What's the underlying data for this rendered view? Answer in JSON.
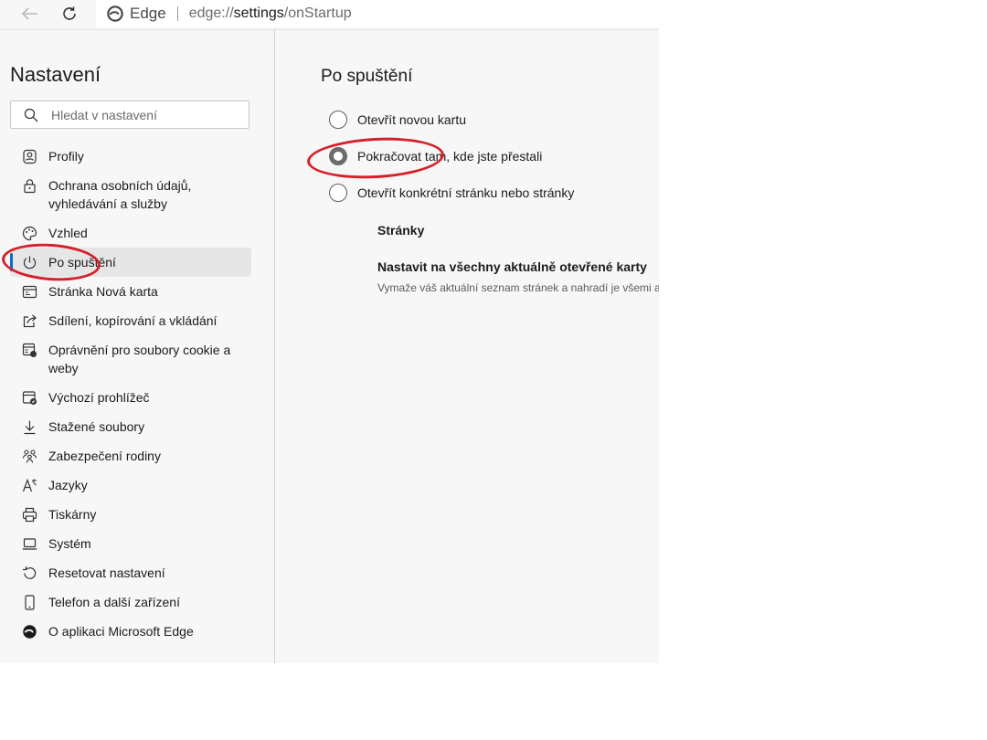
{
  "browser": {
    "name": "Edge",
    "url_scheme": "edge://",
    "url_host": "settings",
    "url_path": "/onStartup"
  },
  "sidebar": {
    "title": "Nastavení",
    "search_placeholder": "Hledat v nastavení",
    "items": [
      {
        "label": "Profily",
        "icon": "profile-icon"
      },
      {
        "label": "Ochrana osobních údajů, vyhledávání a služby",
        "icon": "lock-icon"
      },
      {
        "label": "Vzhled",
        "icon": "palette-icon"
      },
      {
        "label": "Po spuštění",
        "icon": "power-icon",
        "active": true
      },
      {
        "label": "Stránka Nová karta",
        "icon": "new-tab-icon"
      },
      {
        "label": "Sdílení, kopírování a vkládání",
        "icon": "share-icon"
      },
      {
        "label": "Oprávnění pro soubory cookie a weby",
        "icon": "cookie-permissions-icon"
      },
      {
        "label": "Výchozí prohlížeč",
        "icon": "default-browser-icon"
      },
      {
        "label": "Stažené soubory",
        "icon": "download-icon"
      },
      {
        "label": "Zabezpečení rodiny",
        "icon": "family-icon"
      },
      {
        "label": "Jazyky",
        "icon": "language-icon"
      },
      {
        "label": "Tiskárny",
        "icon": "printer-icon"
      },
      {
        "label": "Systém",
        "icon": "laptop-icon"
      },
      {
        "label": "Resetovat nastavení",
        "icon": "reset-icon"
      },
      {
        "label": "Telefon a další zařízení",
        "icon": "phone-icon"
      },
      {
        "label": "O aplikaci Microsoft Edge",
        "icon": "edge-logo-icon"
      }
    ]
  },
  "content": {
    "title": "Po spuštění",
    "options": [
      {
        "label": "Otevřít novou kartu",
        "checked": false
      },
      {
        "label": "Pokračovat tam, kde jste přestali",
        "checked": true
      },
      {
        "label": "Otevřít konkrétní stránku nebo stránky",
        "checked": false
      }
    ],
    "pages_heading": "Stránky",
    "set_all_heading": "Nastavit na všechny aktuálně otevřené karty",
    "set_all_desc": "Vymaže váš aktuální seznam stránek a nahradí je všemi aktuálně otevřenými kartami"
  },
  "colors": {
    "accent": "#0f6cbd",
    "annotation": "#d6202a",
    "radio_checked": "#6b6b6b"
  }
}
